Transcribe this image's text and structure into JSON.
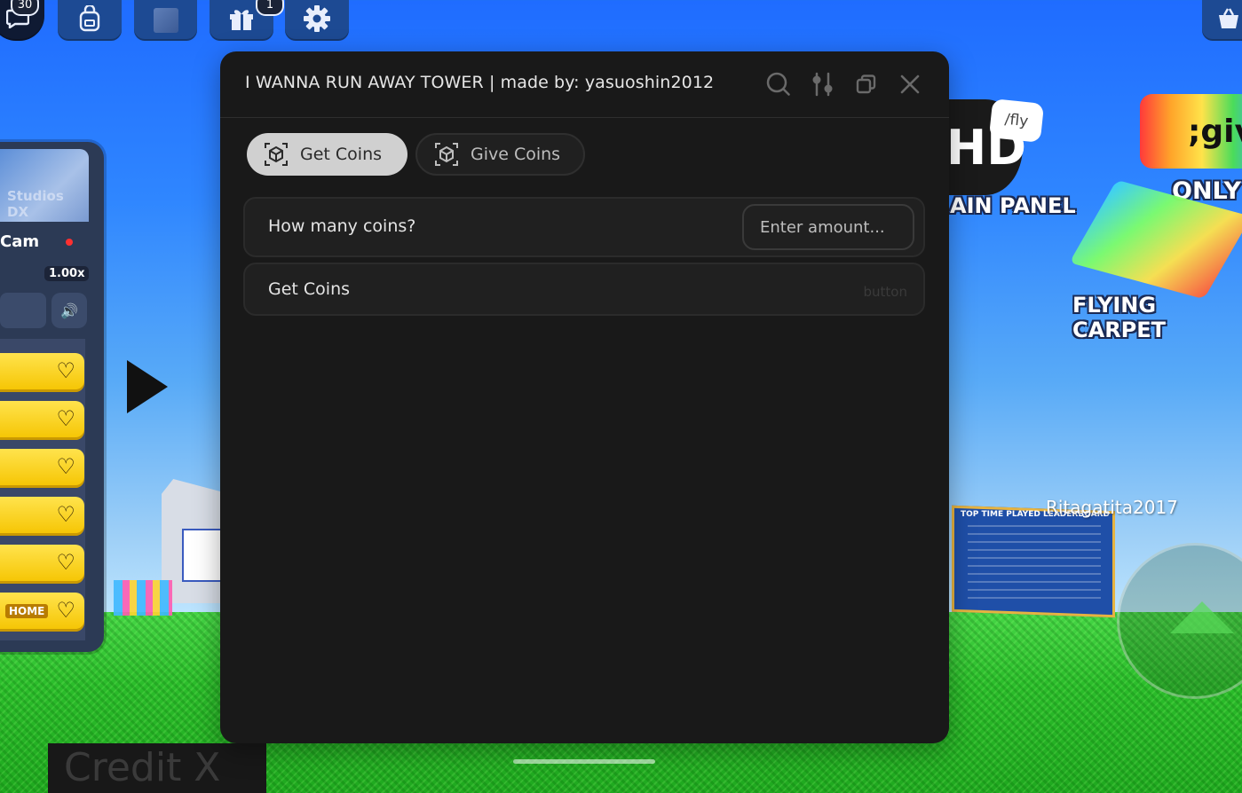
{
  "window": {
    "title": "I WANNA RUN AWAY TOWER | made by: yasuoshin2012"
  },
  "tabs": [
    {
      "label": "Get Coins",
      "active": true
    },
    {
      "label": "Give Coins",
      "active": false
    }
  ],
  "coins_input": {
    "label": "How many coins?",
    "placeholder": "Enter amount..."
  },
  "get_button": {
    "label": "Get Coins",
    "hint": "button"
  },
  "topbar": {
    "chat_badge": "30",
    "gift_badge": "1"
  },
  "left_panel": {
    "studio_title": "Studios DX",
    "cam_label": "Cam",
    "speed": "1.00x",
    "home_tag": "HOME"
  },
  "game": {
    "hd_text": "HD",
    "fly_bubble": "/fly",
    "panel_text": "AIN PANEL",
    "rainbow_text": ";giv",
    "only_text": "ONLY",
    "carpet_text": "FLYING CARPET",
    "leaderboard_title": "TOP TIME PLAYED LEADERBOARD",
    "player_name": "Ritagatita2017",
    "credit_text": "Credit X"
  },
  "colors": {
    "window_bg": "#191919",
    "active_tab": "#d0d0d0",
    "row_bg": "#202020"
  }
}
